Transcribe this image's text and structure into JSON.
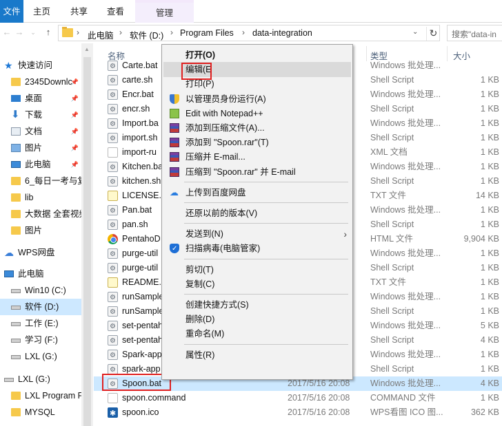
{
  "ribbon": {
    "tabs": [
      "文件",
      "主页",
      "共享",
      "查看"
    ],
    "manage_label": "管理"
  },
  "address": {
    "crumbs": [
      "此电脑",
      "软件 (D:)",
      "Program Files",
      "data-integration"
    ],
    "search_placeholder": "搜索\"data-in"
  },
  "nav": {
    "items": [
      {
        "label": "快速访问",
        "icon": "star-icon"
      },
      {
        "label": "2345Downlc",
        "icon": "folder-icon"
      },
      {
        "label": "桌面",
        "icon": "desktop-icon"
      },
      {
        "label": "下载",
        "icon": "download-icon"
      },
      {
        "label": "文档",
        "icon": "document-icon"
      },
      {
        "label": "图片",
        "icon": "picture-icon"
      },
      {
        "label": "此电脑",
        "icon": "pc-icon"
      },
      {
        "label": "6_每日一考与复",
        "icon": "folder-icon"
      },
      {
        "label": "lib",
        "icon": "folder-icon"
      },
      {
        "label": "大数据 全套视频",
        "icon": "folder-icon"
      },
      {
        "label": "图片",
        "icon": "folder-icon"
      },
      {
        "label": "WPS网盘",
        "icon": "cloud-icon"
      },
      {
        "label": "此电脑",
        "icon": "pc-icon"
      },
      {
        "label": "Win10 (C:)",
        "icon": "drive-icon"
      },
      {
        "label": "软件 (D:)",
        "icon": "drive-icon"
      },
      {
        "label": "工作 (E:)",
        "icon": "drive-icon"
      },
      {
        "label": "学习 (F:)",
        "icon": "drive-icon"
      },
      {
        "label": "LXL (G:)",
        "icon": "drive-icon"
      },
      {
        "label": "LXL (G:)",
        "icon": "drive-icon"
      },
      {
        "label": "LXL Program F",
        "icon": "folder-icon"
      },
      {
        "label": "MYSQL",
        "icon": "folder-icon"
      }
    ]
  },
  "columns": {
    "name": "名称",
    "type": "类型",
    "size": "大小"
  },
  "files": [
    {
      "name": "Carte.bat",
      "date": "",
      "type": "Windows 批处理...",
      "size": "",
      "icon": "bat"
    },
    {
      "name": "carte.sh",
      "date": "",
      "type": "Shell Script",
      "size": "1 KB",
      "icon": "bat"
    },
    {
      "name": "Encr.bat",
      "date": "",
      "type": "Windows 批处理...",
      "size": "1 KB",
      "icon": "bat"
    },
    {
      "name": "encr.sh",
      "date": "",
      "type": "Shell Script",
      "size": "1 KB",
      "icon": "bat"
    },
    {
      "name": "Import.ba",
      "date": "",
      "type": "Windows 批处理...",
      "size": "1 KB",
      "icon": "bat"
    },
    {
      "name": "import.sh",
      "date": "",
      "type": "Shell Script",
      "size": "1 KB",
      "icon": "bat"
    },
    {
      "name": "import-ru",
      "date": "",
      "type": "XML 文档",
      "size": "1 KB",
      "icon": "doc"
    },
    {
      "name": "Kitchen.ba",
      "date": "",
      "type": "Windows 批处理...",
      "size": "1 KB",
      "icon": "bat"
    },
    {
      "name": "kitchen.sh",
      "date": "",
      "type": "Shell Script",
      "size": "1 KB",
      "icon": "bat"
    },
    {
      "name": "LICENSE.t",
      "date": "",
      "type": "TXT 文件",
      "size": "14 KB",
      "icon": "txt"
    },
    {
      "name": "Pan.bat",
      "date": "",
      "type": "Windows 批处理...",
      "size": "1 KB",
      "icon": "bat"
    },
    {
      "name": "pan.sh",
      "date": "",
      "type": "Shell Script",
      "size": "1 KB",
      "icon": "bat"
    },
    {
      "name": "PentahoD",
      "date": "",
      "type": "HTML 文件",
      "size": "9,904 KB",
      "icon": "chrome"
    },
    {
      "name": "purge-util",
      "date": "",
      "type": "Windows 批处理...",
      "size": "1 KB",
      "icon": "bat"
    },
    {
      "name": "purge-util",
      "date": "",
      "type": "Shell Script",
      "size": "1 KB",
      "icon": "bat"
    },
    {
      "name": "README.t",
      "date": "",
      "type": "TXT 文件",
      "size": "1 KB",
      "icon": "txt"
    },
    {
      "name": "runSample",
      "date": "",
      "type": "Windows 批处理...",
      "size": "1 KB",
      "icon": "bat"
    },
    {
      "name": "runSample",
      "date": "",
      "type": "Shell Script",
      "size": "1 KB",
      "icon": "bat"
    },
    {
      "name": "set-pentah",
      "date": "",
      "type": "Windows 批处理...",
      "size": "5 KB",
      "icon": "bat"
    },
    {
      "name": "set-pentah",
      "date": "",
      "type": "Shell Script",
      "size": "4 KB",
      "icon": "bat"
    },
    {
      "name": "Spark-app",
      "date": "",
      "type": "Windows 批处理...",
      "size": "1 KB",
      "icon": "bat"
    },
    {
      "name": "spark-app",
      "date": "",
      "type": "Shell Script",
      "size": "1 KB",
      "icon": "bat"
    },
    {
      "name": "Spoon.bat",
      "date": "2017/5/16 20:08",
      "type": "Windows 批处理...",
      "size": "4 KB",
      "icon": "bat",
      "selected": true
    },
    {
      "name": "spoon.command",
      "date": "2017/5/16 20:08",
      "type": "COMMAND 文件",
      "size": "1 KB",
      "icon": "doc"
    },
    {
      "name": "spoon.ico",
      "date": "2017/5/16 20:08",
      "type": "WPS看图 ICO 图...",
      "size": "362 KB",
      "icon": "wps"
    }
  ],
  "menu": {
    "items": [
      {
        "label": "打开(O)",
        "bold": true,
        "icon": ""
      },
      {
        "label": "编辑(E",
        "highlight": true,
        "icon": ""
      },
      {
        "label": "打印(P)",
        "icon": ""
      },
      {
        "label": "以管理员身份运行(A)",
        "icon": "shield"
      },
      {
        "label": "Edit with Notepad++",
        "icon": "npp"
      },
      {
        "label": "添加到压缩文件(A)...",
        "icon": "rar"
      },
      {
        "label": "添加到 \"Spoon.rar\"(T)",
        "icon": "rar"
      },
      {
        "label": "压缩并 E-mail...",
        "icon": "rar"
      },
      {
        "label": "压缩到 \"Spoon.rar\" 并 E-mail",
        "icon": "rar"
      },
      {
        "sep": true
      },
      {
        "label": "上传到百度网盘",
        "icon": "baidu"
      },
      {
        "sep": true
      },
      {
        "label": "还原以前的版本(V)",
        "icon": ""
      },
      {
        "sep": true
      },
      {
        "label": "发送到(N)",
        "icon": "",
        "submenu": true
      },
      {
        "label": "扫描病毒(电脑管家)",
        "icon": "guard"
      },
      {
        "sep": true
      },
      {
        "label": "剪切(T)",
        "icon": ""
      },
      {
        "label": "复制(C)",
        "icon": ""
      },
      {
        "sep": true
      },
      {
        "label": "创建快捷方式(S)",
        "icon": ""
      },
      {
        "label": "删除(D)",
        "icon": ""
      },
      {
        "label": "重命名(M)",
        "icon": ""
      },
      {
        "sep": true
      },
      {
        "label": "属性(R)",
        "icon": ""
      }
    ]
  },
  "colors": {
    "file_tab": "#1979ca",
    "selection": "#cce8ff",
    "highlight_box": "#e02020"
  }
}
